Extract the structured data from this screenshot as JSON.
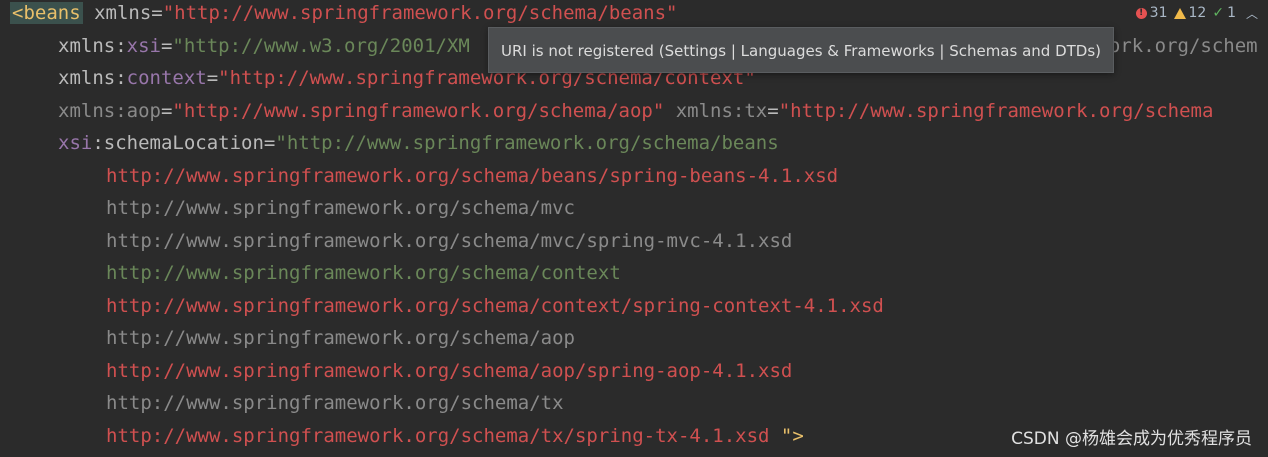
{
  "status": {
    "errors": "31",
    "warnings": "12",
    "typos": "1",
    "error_color": "#e55252",
    "warning_color": "#f0b94a",
    "check_color": "#5fb25f"
  },
  "tooltip": {
    "text": "URI is not registered (Settings | Languages & Frameworks | Schemas and DTDs)"
  },
  "code": {
    "line1": {
      "tag": "<beans",
      "attr": " xmlns",
      "eq": "=",
      "value": "\"http://www.springframework.org/schema/beans\""
    },
    "line2": {
      "prefix": "xmlns:",
      "ns": "xsi",
      "eq": "=",
      "value": "\"http://www.w3.org/2001/XM",
      "tail": "ework.org/schem"
    },
    "line3": {
      "prefix": "xmlns:",
      "ns": "context",
      "eq": "=",
      "value": "\"http://www.springframework.org/schema/context\""
    },
    "line4": {
      "attr1": "xmlns:aop",
      "eq": "=",
      "value1": "\"http://www.springframework.org/schema/aop\"",
      "attr2": " xmlns:tx",
      "value2": "\"http://www.springframework.org/schema"
    },
    "line5": {
      "ns": "xsi",
      "attr": ":schemaLocation",
      "eq": "=",
      "value": "\"http://www.springframework.org/schema/beans"
    },
    "locations": [
      {
        "text": "http://www.springframework.org/schema/beans/spring-beans-4.1.xsd",
        "style": "red"
      },
      {
        "text": "http://www.springframework.org/schema/mvc",
        "style": "gray"
      },
      {
        "text": "http://www.springframework.org/schema/mvc/spring-mvc-4.1.xsd",
        "style": "gray"
      },
      {
        "text": "http://www.springframework.org/schema/context",
        "style": "green"
      },
      {
        "text": "http://www.springframework.org/schema/context/spring-context-4.1.xsd",
        "style": "red"
      },
      {
        "text": "http://www.springframework.org/schema/aop",
        "style": "gray"
      },
      {
        "text": "http://www.springframework.org/schema/aop/spring-aop-4.1.xsd",
        "style": "red"
      },
      {
        "text": "http://www.springframework.org/schema/tx",
        "style": "gray"
      },
      {
        "text": "http://www.springframework.org/schema/tx/spring-tx-4.1.xsd",
        "style": "red"
      }
    ],
    "closing": " \">"
  },
  "watermark": "CSDN @杨雄会成为优秀程序员"
}
